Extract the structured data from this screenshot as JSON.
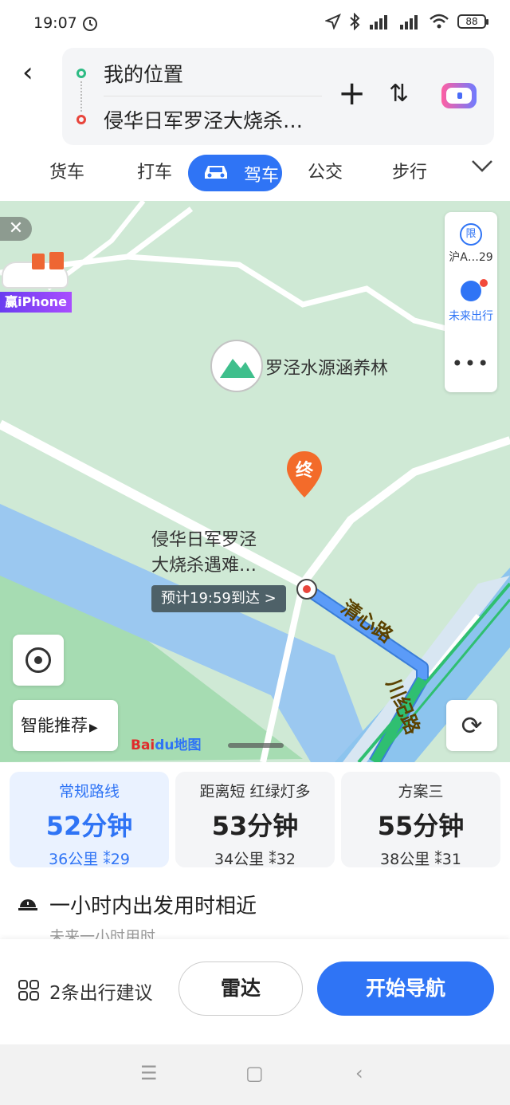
{
  "status": {
    "time": "19:07",
    "battery": "88"
  },
  "route": {
    "from": "我的位置",
    "to": "侵华日军罗泾大烧杀…"
  },
  "modes": {
    "truck": "货车",
    "taxi": "打车",
    "drive": "驾车",
    "bus": "公交",
    "walk": "步行"
  },
  "map": {
    "ad_label": "赢iPhone",
    "limit_label": "限",
    "plate": "沪A…29",
    "future": "未来出行",
    "more": "•••",
    "poi": "罗泾水源涵养林",
    "end_marker": "终",
    "dest_name_line1": "侵华日军罗泾",
    "dest_name_line2": "大烧杀遇难…",
    "eta": "预计19:59到达 >",
    "road1": "清心路",
    "road2": "川纪路",
    "smart": "智能推荐",
    "baidu_a": "Bai",
    "baidu_b": "du地图"
  },
  "routes": [
    {
      "tag": "常规路线",
      "duration": "52分钟",
      "meta": "36公里 ⁢ 29",
      "km": "36公里",
      "lights": "29",
      "selected": true
    },
    {
      "tag": "距离短  红绿灯多",
      "duration": "53分钟",
      "km": "34公里",
      "lights": "32"
    },
    {
      "tag": "方案三",
      "duration": "55分钟",
      "km": "38公里",
      "lights": "31"
    }
  ],
  "hint": {
    "title": "一小时内出发用时相近",
    "sub": "未来一小时用时"
  },
  "bottom": {
    "suggest": "2条出行建议",
    "radar": "雷达",
    "navigate": "开始导航"
  },
  "colors": {
    "accent": "#2f74f5",
    "route_blue": "#4d8df6",
    "route_green": "#2fbf71",
    "map_bg": "#cfe9d5",
    "water": "#9bc8f0"
  }
}
